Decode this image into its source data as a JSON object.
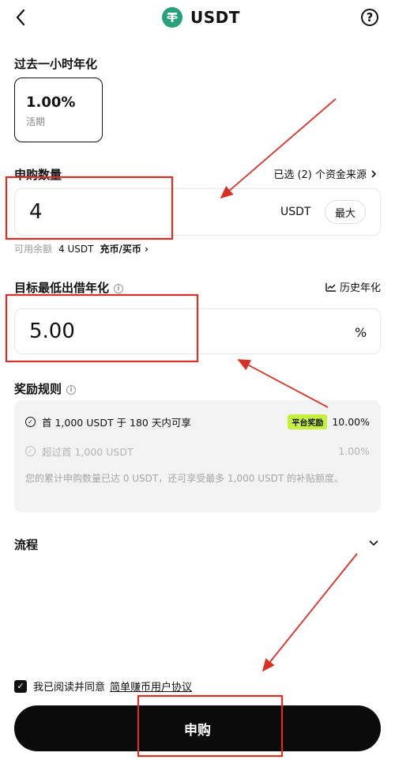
{
  "header": {
    "title": "USDT",
    "back_icon": "chevron-left-icon",
    "help_icon": "question-circle-icon",
    "token_icon": "tether-icon"
  },
  "apy": {
    "label": "过去一小时年化",
    "value": "1.00%",
    "sub": "活期"
  },
  "subscribe": {
    "label": "申购数量",
    "source_text": "已选 (2) 个资金来源",
    "amount": "4",
    "unit": "USDT",
    "max_label": "最大",
    "balance_label": "可用余额",
    "balance_value": "4 USDT",
    "deposit_link": "充币/买币"
  },
  "target": {
    "label": "目标最低出借年化",
    "history_label": "历史年化",
    "value": "5.00",
    "unit": "%"
  },
  "rules": {
    "label": "奖励规则",
    "row1_text": "首 1,000 USDT 于 180 天内可享",
    "row1_badge": "平台奖励",
    "row1_rate": "10.00%",
    "row2_text": "超过首 1,000 USDT",
    "row2_rate": "1.00%",
    "note": "您的累计申购数量已达 0 USDT，还可享受最多 1,000 USDT 的补贴额度。"
  },
  "process": {
    "label": "流程"
  },
  "agreement": {
    "prefix": "我已阅读并同意",
    "link": "简单赚币用户协议",
    "checked": true
  },
  "submit_label": "申购",
  "colors": {
    "accent_green": "#c5f03d",
    "tether": "#26a17b",
    "annotation_red": "#d93025",
    "button_bg": "#0b0b0b"
  }
}
